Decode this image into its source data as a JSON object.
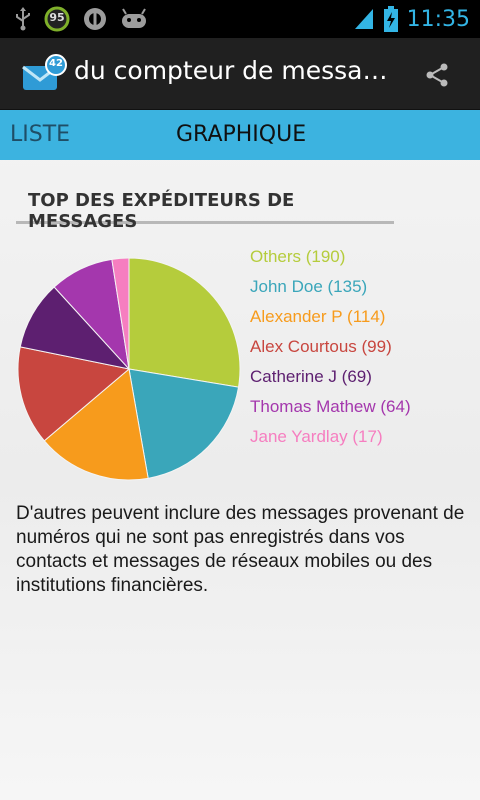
{
  "status_bar": {
    "battery_level_badge": "95",
    "time": "11:35"
  },
  "action_bar": {
    "app_badge": "42",
    "title": "du compteur de messag…"
  },
  "tabs": [
    {
      "label": "LISTE",
      "selected": false
    },
    {
      "label": "GRAPHIQUE",
      "selected": true
    }
  ],
  "section_title": "TOP DES EXPÉDITEURS DE MESSAGES",
  "chart_data": {
    "type": "pie",
    "slices": [
      {
        "label": "Others",
        "value": 190,
        "legend": "Others (190)",
        "color": "#b5cc3c"
      },
      {
        "label": "John Doe",
        "value": 135,
        "legend": "John Doe (135)",
        "color": "#3aa6ba"
      },
      {
        "label": "Alexander P",
        "value": 114,
        "legend": "Alexander P (114)",
        "color": "#f79b1c"
      },
      {
        "label": "Alex Courtous",
        "value": 99,
        "legend": "Alex Courtous (99)",
        "color": "#c8463f"
      },
      {
        "label": "Catherine J",
        "value": 69,
        "legend": "Catherine J (69)",
        "color": "#5d1f70"
      },
      {
        "label": "Thomas Mathew",
        "value": 64,
        "legend": "Thomas Mathew (64)",
        "color": "#a437ad"
      },
      {
        "label": "Jane Yardlay",
        "value": 17,
        "legend": "Jane Yardlay (17)",
        "color": "#f67ec0"
      }
    ],
    "legend_position": "right"
  },
  "note": "D'autres peuvent inclure des messages provenant de numéros qui ne sont pas enregistrés dans vos contacts et messages de réseaux mobiles ou des institutions financières.",
  "icons": {
    "usb": "usb-icon",
    "battery_badge": "battery-level-icon",
    "sync": "sync-icon",
    "android": "android-icon",
    "signal": "signal-icon",
    "battery": "battery-icon",
    "app": "app-icon",
    "share": "share-icon"
  }
}
